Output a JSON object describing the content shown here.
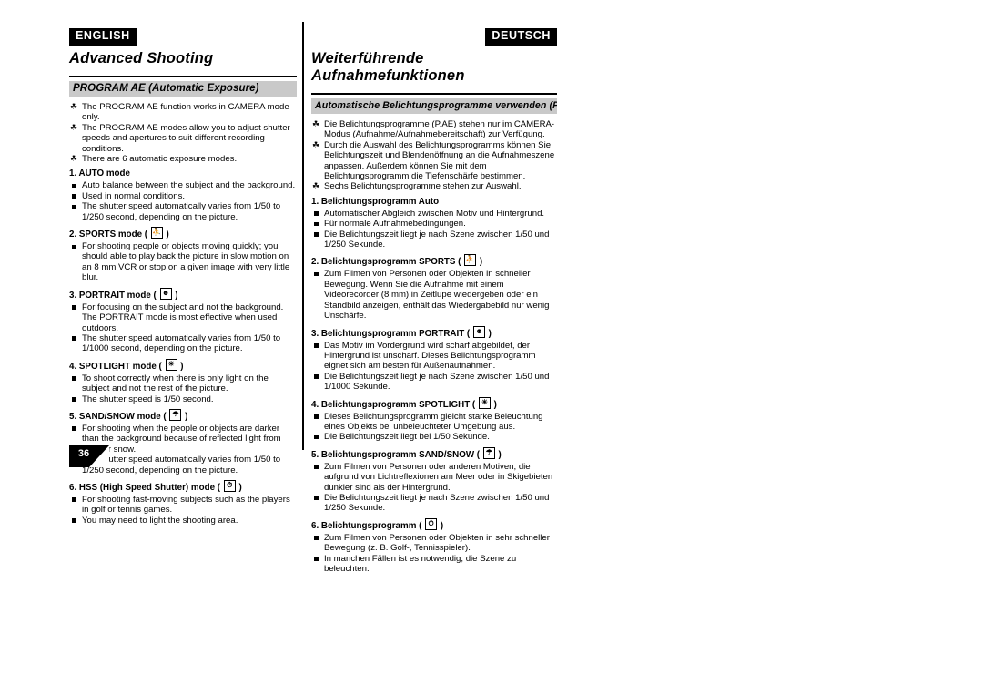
{
  "page": {
    "number": "36"
  },
  "left": {
    "lang_badge": "ENGLISH",
    "chapter_title": "Advanced Shooting",
    "section_bar": "PROGRAM AE (Automatic Exposure)",
    "intro": [
      "The PROGRAM AE function works in CAMERA mode only.",
      "The PROGRAM AE modes allow you to adjust shutter speeds and apertures to suit different recording conditions.",
      "There are 6 automatic exposure modes."
    ],
    "items": [
      {
        "heading": "1. AUTO mode",
        "icon": "",
        "bullets": [
          "Auto balance between the subject and the background.",
          "Used in normal conditions.",
          "The shutter speed automatically varies from 1/50 to 1/250 second, depending on the picture."
        ]
      },
      {
        "heading": "2. SPORTS mode (",
        "heading_tail": ")",
        "icon": "runner-icon",
        "bullets": [
          "For shooting people or objects moving quickly; you should able to play back the picture in slow motion on an 8 mm VCR or stop on a given image with very little blur."
        ]
      },
      {
        "heading": "3. PORTRAIT mode (",
        "heading_tail": ")",
        "icon": "portrait-icon",
        "bullets": [
          "For focusing on the subject and not the background. The PORTRAIT mode is most effective when used outdoors.",
          "The shutter speed automatically varies from 1/50 to 1/1000 second, depending on the picture."
        ]
      },
      {
        "heading": "4. SPOTLIGHT mode (",
        "heading_tail": ")",
        "icon": "spotlight-icon",
        "bullets": [
          "To shoot correctly when there is only light on the subject and not the rest of the picture.",
          "The shutter speed is 1/50 second."
        ]
      },
      {
        "heading": "5. SAND/SNOW mode (",
        "heading_tail": ")",
        "icon": "sandsnow-icon",
        "bullets": [
          "For shooting when the people or objects are darker than the background because of reflected light from sand or snow.",
          "The shutter speed automatically varies from 1/50 to 1/250 second, depending on the picture."
        ]
      },
      {
        "heading": "6. HSS (High Speed Shutter) mode (",
        "heading_tail": ")",
        "icon": "hss-icon",
        "bullets": [
          "For shooting fast-moving subjects such as the players in golf or tennis games.",
          "You may need to light the shooting area."
        ]
      }
    ]
  },
  "right": {
    "lang_badge": "DEUTSCH",
    "chapter_title": "Weiterführende Aufnahmefunktionen",
    "section_bar": "Automatische Belichtungsprogramme verwenden (P.AE)",
    "intro": [
      "Die Belichtungsprogramme (P.AE) stehen nur im CAMERA-Modus (Aufnahme/Aufnahmebereitschaft) zur Verfügung.",
      "Durch die Auswahl des Belichtungsprogramms können Sie Belichtungszeit und Blendenöffnung an die Aufnahmeszene anpassen. Außerdem können Sie mit dem Belichtungsprogramm die Tiefenschärfe bestimmen.",
      "Sechs Belichtungsprogramme stehen zur Auswahl."
    ],
    "items": [
      {
        "heading": "1. Belichtungsprogramm Auto",
        "icon": "",
        "bullets": [
          "Automatischer Abgleich zwischen Motiv und Hintergrund.",
          "Für normale Aufnahmebedingungen.",
          "Die Belichtungszeit liegt je nach Szene zwischen 1/50 und 1/250 Sekunde."
        ]
      },
      {
        "heading": "2. Belichtungsprogramm SPORTS (",
        "heading_tail": ")",
        "icon": "runner-icon",
        "bullets": [
          "Zum Filmen von Personen oder Objekten in schneller Bewegung. Wenn Sie die Aufnahme mit einem Videorecorder (8 mm) in Zeitlupe wiedergeben oder ein Standbild anzeigen, enthält das Wiedergabebild nur wenig Unschärfe."
        ]
      },
      {
        "heading": "3. Belichtungsprogramm PORTRAIT (",
        "heading_tail": ")",
        "icon": "portrait-icon",
        "bullets": [
          "Das Motiv im Vordergrund wird scharf abgebildet, der Hintergrund ist unscharf. Dieses Belichtungsprogramm eignet sich am besten für Außenaufnahmen.",
          "Die Belichtungszeit liegt je nach Szene zwischen 1/50 und 1/1000 Sekunde."
        ]
      },
      {
        "heading": "4. Belichtungsprogramm SPOTLIGHT (",
        "heading_tail": ")",
        "icon": "spotlight-icon",
        "bullets": [
          "Dieses Belichtungsprogramm gleicht starke Beleuchtung eines Objekts bei unbeleuchteter Umgebung aus.",
          "Die Belichtungszeit liegt bei 1/50 Sekunde."
        ]
      },
      {
        "heading": "5. Belichtungsprogramm SAND/SNOW (",
        "heading_tail": ")",
        "icon": "sandsnow-icon",
        "bullets": [
          "Zum Filmen von Personen oder anderen Motiven, die aufgrund von Lichtreflexionen am Meer oder in Skigebieten dunkler sind als der Hintergrund.",
          "Die Belichtungszeit liegt je nach Szene zwischen 1/50 und 1/250 Sekunde."
        ]
      },
      {
        "heading": "6. Belichtungsprogramm (",
        "heading_tail": ")",
        "icon": "hss-icon",
        "bullets": [
          "Zum Filmen von Personen oder Objekten in sehr schneller Bewegung (z. B. Golf-, Tennisspieler).",
          "In manchen Fällen ist es notwendig, die Szene zu beleuchten."
        ]
      }
    ]
  }
}
